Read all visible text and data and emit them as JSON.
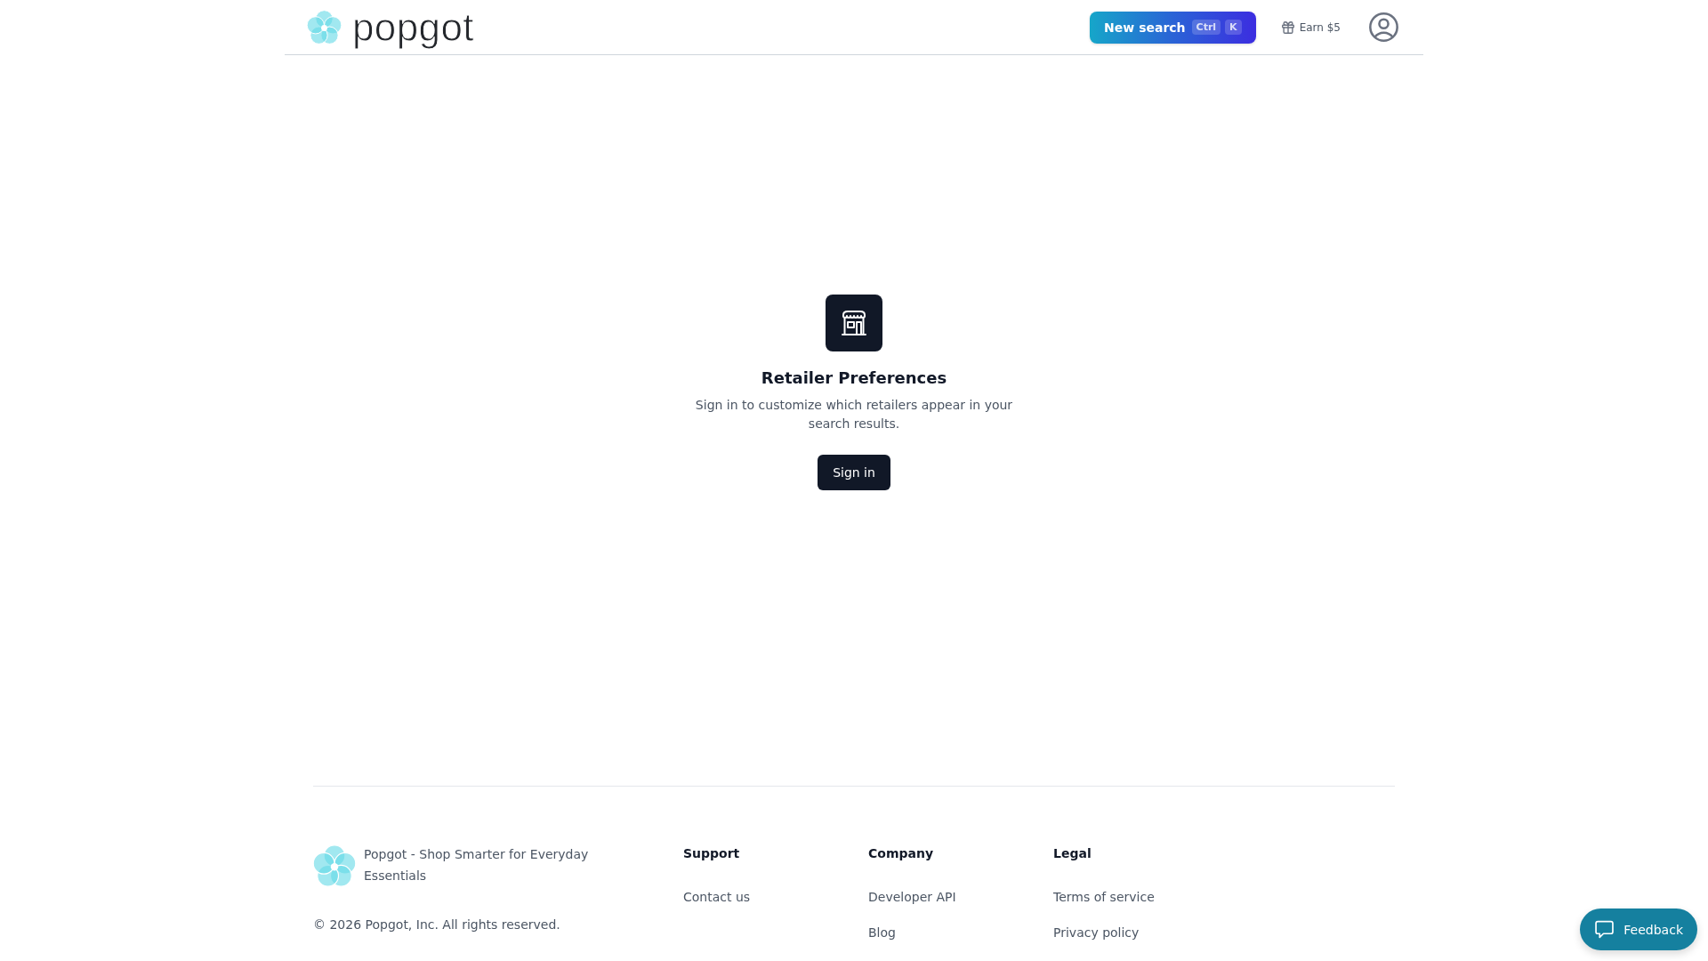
{
  "header": {
    "logo_text": "popgot",
    "search_button": {
      "label": "New search",
      "shortcut": [
        "Ctrl",
        "K"
      ]
    },
    "earn_link": "Earn $5"
  },
  "empty_state": {
    "title": "Retailer Preferences",
    "message": "Sign in to customize which retailers appear in your search results.",
    "button": "Sign in"
  },
  "footer": {
    "tagline": "Popgot - Shop Smarter for Everyday Essentials",
    "copyright": "© 2026 Popgot, Inc. All rights reserved.",
    "columns": [
      {
        "heading": "Support",
        "links": [
          "Contact us"
        ]
      },
      {
        "heading": "Company",
        "links": [
          "Developer API",
          "Blog"
        ]
      },
      {
        "heading": "Legal",
        "links": [
          "Terms of service",
          "Privacy policy"
        ]
      }
    ]
  },
  "feedback_button": "Feedback"
}
